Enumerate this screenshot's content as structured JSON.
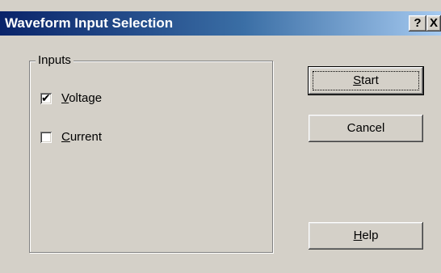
{
  "window": {
    "title": "Waveform Input Selection",
    "help_caption": "?",
    "close_caption": "X"
  },
  "inputs_group": {
    "label": "Inputs",
    "options": [
      {
        "mnemonic": "V",
        "rest": "oltage",
        "checked": true
      },
      {
        "mnemonic": "C",
        "rest": "urrent",
        "checked": false
      }
    ]
  },
  "buttons": {
    "start": {
      "mnemonic": "S",
      "rest": "tart"
    },
    "cancel": {
      "label": "Cancel"
    },
    "help": {
      "mnemonic": "H",
      "rest": "elp"
    }
  }
}
